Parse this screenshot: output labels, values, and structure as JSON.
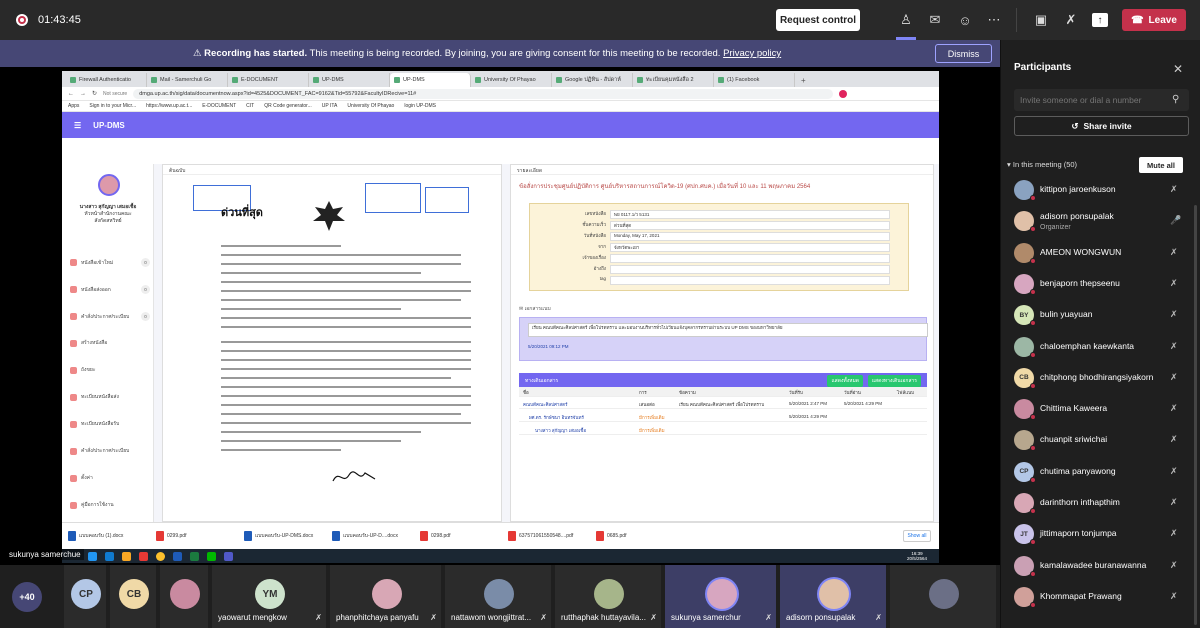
{
  "topbar": {
    "timer": "01:43:45",
    "request_control": "Request control",
    "leave": "Leave"
  },
  "banner": {
    "recording": "Recording has started.",
    "message": "This meeting is being recorded. By joining, you are giving consent for this meeting to be recorded.",
    "privacy_link": "Privacy policy",
    "dismiss": "Dismiss"
  },
  "browser": {
    "tabs": [
      "Firewall Authenticatio",
      "Mail - Samerchuli Go",
      "E-DOCUMENT",
      "UP-DMS",
      "UP-DMS",
      "University Of Phayao",
      "Google ปฏิทิน - สัปดาห์",
      "ทะเบียนคุมหนังสือ 2",
      "(1) Facebook"
    ],
    "url": "dmga.up.ac.th/sig/data/documentnow.aspx?id=4525&DOCUMENT_FAC=9162&Tid=55792&FacultyIDRecive=11#",
    "url_prefix": "Not secure",
    "bookmarks": [
      "Apps",
      "Sign in to your Micr...",
      "https://www.up.ac.t...",
      "E-DOCUMENT",
      "CIT",
      "QR Code generator...",
      "UP ITA",
      "University Of Phayao",
      "login UP-DMS"
    ],
    "app_name": "UP-DMS",
    "user_name": "นางสาว สุกัญญา เสมอเชื้อ",
    "user_role": "หัวหน้าสำนักงานคณะ",
    "user_unit": "สังกัดสหวิทย์",
    "menu": [
      {
        "label": "หนังสือเข้าใหม่",
        "count": "0"
      },
      {
        "label": "หนังสือส่งออก",
        "count": "0"
      },
      {
        "label": "คำสั่ง/ประกาศ/ระเบียบ",
        "count": "0"
      },
      {
        "label": "สร้างหนังสือ",
        "count": ""
      },
      {
        "label": "ถังขยะ",
        "count": ""
      },
      {
        "label": "ทะเบียนหนังสือส่ง",
        "count": ""
      },
      {
        "label": "ทะเบียนหนังสือรับ",
        "count": ""
      },
      {
        "label": "คำสั่ง/ประกาศ/ระเบียบ",
        "count": ""
      },
      {
        "label": "ตั้งค่า",
        "count": ""
      },
      {
        "label": "คู่มือการใช้งาน",
        "count": ""
      }
    ],
    "doc_panel_header": "ต้นฉบับ",
    "doc_urgent": "ด่วนที่สุด",
    "info_panel_header": "รายละเอียด",
    "info_title": "ข้อสั่งการประชุมศูนย์ปฏิบัติการ ศูนย์บริหารสถานการณ์โควิด-19 (ศปก.ศบค.) เมื่อวันที่ 10 และ 11 พฤษภาคม 2564",
    "meta": [
      {
        "k": "เลขหนังสือ",
        "v": "พย 0117.1/ว 5131"
      },
      {
        "k": "ชั้นความเร็ว",
        "v": "ด่วนที่สุด"
      },
      {
        "k": "วันที่หนังสือ",
        "v": "Monday, May 17, 2021"
      },
      {
        "k": "จาก",
        "v": "จังหวัดพะเยา"
      },
      {
        "k": "เจ้าของเรื่อง",
        "v": ""
      },
      {
        "k": "อ้างถึง",
        "v": ""
      },
      {
        "k": "tag",
        "v": ""
      }
    ],
    "attach_label": "เอกสารแนบ",
    "msg_text": "เรียน คณบดีคณะศิลปศาสตร์ เพื่อโปรดทราบ และมอบงานบริหารทั่วไปเวียนแจ้งบุคลากรทราบผ่านระบบ UP DMS ของมหาวิทยาลัย",
    "msg_date": "5/20/2021",
    "msg_time": "09:12 PM",
    "route_header": "ทางเดินเอกสาร",
    "route_btn1": "แสดงทั้งหมด",
    "route_btn2": "แสดงทางเดินเอกสาร",
    "route_cols": [
      "ชื่อ",
      "การ",
      "ข้อความ",
      "วันที่รับ",
      "วันที่อ่าน",
      "ไฟล์แนบ"
    ],
    "route_rows": [
      {
        "name": "คณบดีคณะศิลปศาสตร์",
        "action": "เสนอต่อ",
        "msg": "เรียน คณบดีคณะศิลปศาสตร์ เพื่อโปรดทราบ",
        "recv": "5/20/2021 2:47 PM",
        "read": "5/20/2021 4:29 PM"
      },
      {
        "name": "ผศ.ดร. รักษ์ชนา อินทรจันทร์",
        "action": "มีการเพิ่มเติม",
        "msg": "",
        "recv": "5/20/2021 4:29 PM",
        "read": ""
      },
      {
        "name": "นางสาว สุกัญญา เสมอเชื้อ",
        "action": "มีการเพิ่มเติม",
        "msg": "",
        "recv": "",
        "read": ""
      }
    ],
    "downloads": [
      "แบบคอบรับ (1).docx",
      "0299.pdf",
      "แบบคอบรับ-UP-DMS.docx",
      "แบบคอบรับ-UP-D....docx",
      "0298.pdf",
      "637571061550548....pdf",
      "0685.pdf"
    ],
    "show_all": "Show all",
    "clock_time": "16:39",
    "clock_date": "20/5/2564"
  },
  "presenter_label": "sukunya samerchue",
  "gallery": {
    "overflow": "+40",
    "tiles": [
      {
        "initials": "CP",
        "name": "",
        "color": "#b3c7e6"
      },
      {
        "initials": "CB",
        "name": "",
        "color": "#f0d9a7"
      },
      {
        "initials": "",
        "name": "",
        "color": "#c98aa0"
      },
      {
        "initials": "YM",
        "name": "yaowarut mengkow",
        "color": "#cde2cc"
      },
      {
        "initials": "",
        "name": "phanphitchaya panyafu",
        "color": "#d8a7b5"
      },
      {
        "initials": "",
        "name": "nattawom wongjittrat...",
        "color": "#7a8ca8"
      },
      {
        "initials": "",
        "name": "rutthaphak huttayavila...",
        "color": "#a6b58a"
      },
      {
        "initials": "",
        "name": "sukunya samerchur",
        "color": "#d7a6c0"
      },
      {
        "initials": "",
        "name": "adisorn ponsupalak",
        "color": "#e0c0a8"
      },
      {
        "initials": "",
        "name": "",
        "color": "#6b6f86"
      }
    ]
  },
  "participants": {
    "title": "Participants",
    "invite_placeholder": "Invite someone or dial a number",
    "share_invite": "Share invite",
    "in_meeting": "In this meeting (50)",
    "mute_all": "Mute all",
    "list": [
      {
        "name": "kittipon jaroenkuson",
        "role": "",
        "initials": "",
        "color": "#8aa2c0"
      },
      {
        "name": "adisorn ponsupalak",
        "role": "Organizer",
        "initials": "",
        "color": "#e0c0a8"
      },
      {
        "name": "AMEON WONGWUN",
        "role": "",
        "initials": "",
        "color": "#b08a6a"
      },
      {
        "name": "benjaporn thepseenu",
        "role": "",
        "initials": "",
        "color": "#d7a6c0"
      },
      {
        "name": "bulin yuayuan",
        "role": "",
        "initials": "BY",
        "color": "#d6e6b8"
      },
      {
        "name": "chaloemphan kaewkanta",
        "role": "",
        "initials": "",
        "color": "#9cb7a5"
      },
      {
        "name": "chitphong bhodhirangsiyakorn",
        "role": "",
        "initials": "CB",
        "color": "#f0d9a7"
      },
      {
        "name": "Chittima Kaweera",
        "role": "",
        "initials": "",
        "color": "#c98aa0"
      },
      {
        "name": "chuanpit sriwichai",
        "role": "",
        "initials": "",
        "color": "#b7a78e"
      },
      {
        "name": "chutima panyawong",
        "role": "",
        "initials": "CP",
        "color": "#b3c7e6"
      },
      {
        "name": "darinthorn inthapthim",
        "role": "",
        "initials": "",
        "color": "#d8a7b5"
      },
      {
        "name": "jittimaporn tonjumpa",
        "role": "",
        "initials": "JT",
        "color": "#c9c3ea"
      },
      {
        "name": "kamalawadee buranawanna",
        "role": "",
        "initials": "",
        "color": "#caa0b4"
      },
      {
        "name": "Khommapat Prawang",
        "role": "",
        "initials": "",
        "color": "#d0a09a"
      }
    ]
  }
}
